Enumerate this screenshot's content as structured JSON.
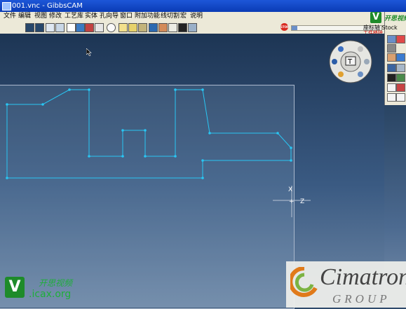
{
  "window": {
    "title": "001.vnc - GibbsCAM"
  },
  "menu": {
    "items": [
      "文件",
      "编辑",
      "视图",
      "修改",
      "工艺库",
      "实体",
      "孔向导",
      "窗口",
      "附加功能",
      "线切割",
      "宏",
      "说明"
    ]
  },
  "toolbar": {
    "icons": [
      "geometry-icon",
      "curve-icon",
      "solid-icon",
      "surface-icon",
      "info-icon",
      "tools-icon",
      "process-icon",
      "ops-icon",
      "render-icon",
      "machine-icon",
      "cut-icon",
      "chip-icon",
      "holder-icon",
      "sync-icon",
      "drive-icon",
      "doc-icon",
      "help-icon"
    ],
    "stop_label": "STOP",
    "progress_fraction": 0.06
  },
  "watermark_top": {
    "logo": "V",
    "brand": "开思视频",
    "line1": "座标轴  Stock",
    "line2": "工件移除"
  },
  "viewport": {
    "axis_x": "X",
    "axis_z": "Z"
  },
  "watermark_bottom": {
    "logo": "V",
    "brand": "开思视频",
    "site": ".icax.org"
  },
  "cimatron": {
    "name": "Cimatron",
    "group": "GROUP"
  }
}
